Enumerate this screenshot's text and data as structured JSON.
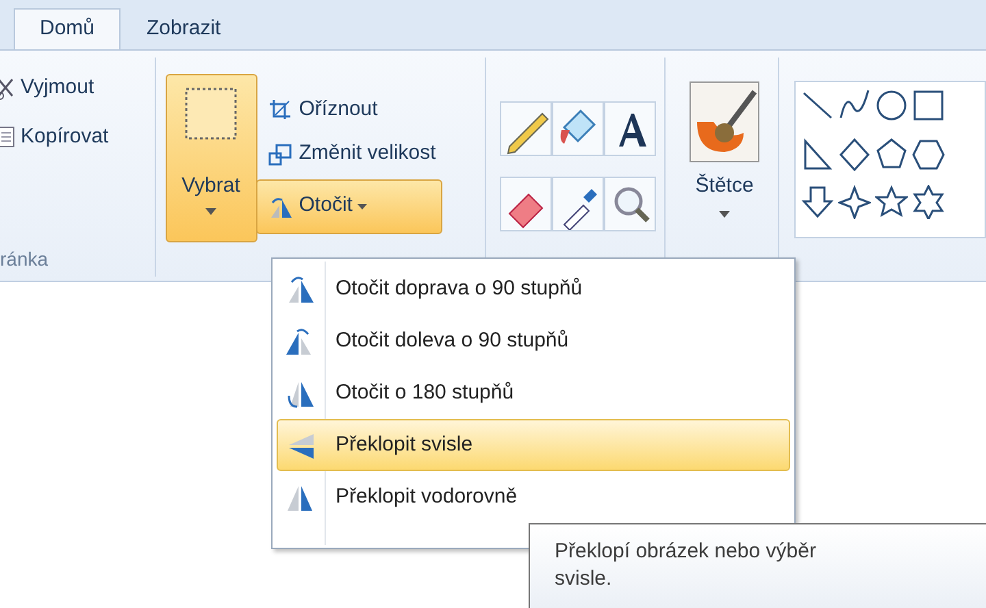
{
  "tabs": [
    {
      "label": "Domů",
      "selected": true
    },
    {
      "label": "Zobrazit",
      "selected": false
    }
  ],
  "clipboard": {
    "items": [
      {
        "label": "Vyjmout"
      },
      {
        "label": "Kopírovat"
      }
    ],
    "group_label": "ránka"
  },
  "image": {
    "select_button": {
      "label": "Vybrat",
      "pressed": true
    },
    "items": [
      {
        "label": "Oříznout"
      },
      {
        "label": "Změnit velikost"
      }
    ],
    "rotate_button": {
      "label": "Otočit",
      "pressed": true
    }
  },
  "brushes": {
    "label": "Štětce"
  },
  "rotate_menu": {
    "items": [
      {
        "label": "Otočit doprava o 90 stupňů",
        "selected": false
      },
      {
        "label": "Otočit doleva o 90 stupňů",
        "selected": false
      },
      {
        "label": "Otočit o 180 stupňů",
        "selected": false
      },
      {
        "label": "Překlopit svisle",
        "selected": true
      },
      {
        "label": "Překlopit vodorovně",
        "selected": false
      }
    ]
  },
  "tooltip": {
    "text": "Překlopí obrázek nebo výběr svisle."
  }
}
